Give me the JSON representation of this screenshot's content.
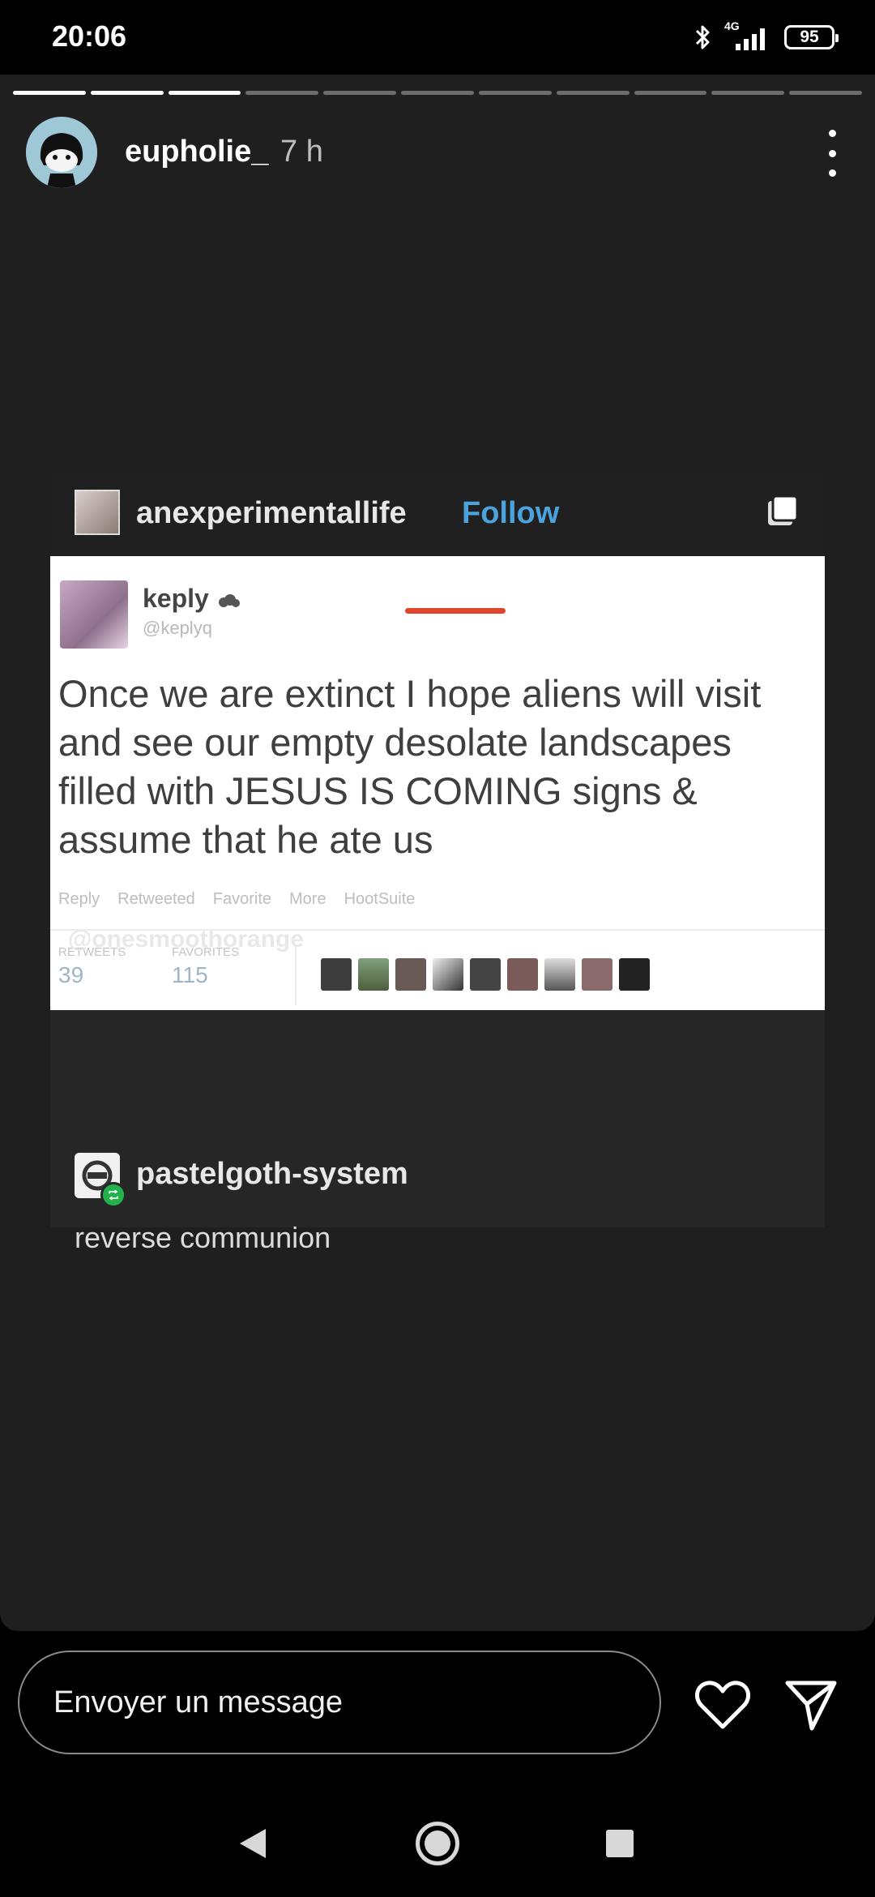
{
  "status_bar": {
    "time": "20:06",
    "network": "4G",
    "battery": "95",
    "icons": [
      "bluetooth-icon",
      "signal-icon",
      "battery-icon"
    ]
  },
  "story": {
    "progress": {
      "total_segments": 11,
      "completed_segments": 3
    },
    "username": "eupholie_",
    "age": "7 h"
  },
  "post": {
    "blog_name": "anexperimentallife",
    "follow_label": "Follow",
    "tweet": {
      "name": "keply",
      "handle": "@keplyq",
      "text": "Once we are extinct I hope aliens will visit and see our empty desolate landscapes filled with JESUS IS COMING signs & assume that he ate us",
      "actions": [
        "Reply",
        "Retweeted",
        "Favorite",
        "More",
        "HootSuite"
      ],
      "retweets_label": "RETWEETS",
      "retweets": "39",
      "favorites_label": "FAVORITES",
      "favorites": "115"
    },
    "reblogger": "pastelgoth-system",
    "reblog_text": "reverse communion"
  },
  "credit": "@onesmoothorange",
  "reply": {
    "placeholder": "Envoyer un message"
  },
  "colors": {
    "follow": "#4ba3dd",
    "story_bg": "#1f1f1f",
    "reblog_badge": "#22b14c",
    "underline": "#e0452d"
  }
}
